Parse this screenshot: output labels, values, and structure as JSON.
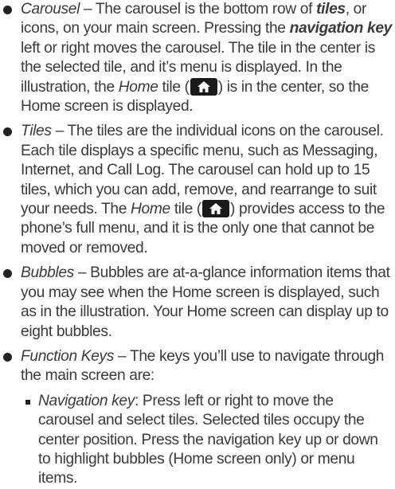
{
  "items": [
    {
      "term": "Carousel",
      "t1": " – The carousel is the bottom row of ",
      "kw1": "tiles",
      "t2": ", or icons, on your main screen. Pressing the ",
      "kw2": "navigation key",
      "t3": " left or right moves the carousel. The tile in the center is the selected tile, and it’s menu is displayed. In the illustration, the ",
      "kw3": "Home",
      "t4": " tile (",
      "t5": ") is in the center, so the Home screen is displayed."
    },
    {
      "term": "Tiles",
      "t1": " – The tiles are the individual icons on the carousel. Each tile displays a specific menu, such as Messaging, Internet, and Call Log. The carousel can hold up to 15 tiles, which you can add, remove, and rearrange to suit your needs. The ",
      "kw1": "Home",
      "t2": " tile (",
      "t3": ") provides access to the phone’s full menu, and it is the only one that cannot be moved or removed."
    },
    {
      "term": "Bubbles",
      "t1": " – Bubbles are at-a-glance information items that you may see when the Home screen is displayed, such as in the illustration. Your Home screen can display up to eight bubbles."
    },
    {
      "term": "Function Keys",
      "t1": " – The keys you’ll use to navigate through the main screen are:"
    }
  ],
  "subitems": [
    {
      "term": "Navigation key",
      "t1": ": Press left or right to move the carousel and select tiles. Selected tiles occupy the center position. Press the navigation key up or down to highlight bubbles (Home screen only) or menu items."
    }
  ],
  "icons": {
    "home_tile": "home-icon"
  },
  "colors": {
    "tile_bg": "#1a1a1a",
    "icon_fg": "#ffffff"
  }
}
